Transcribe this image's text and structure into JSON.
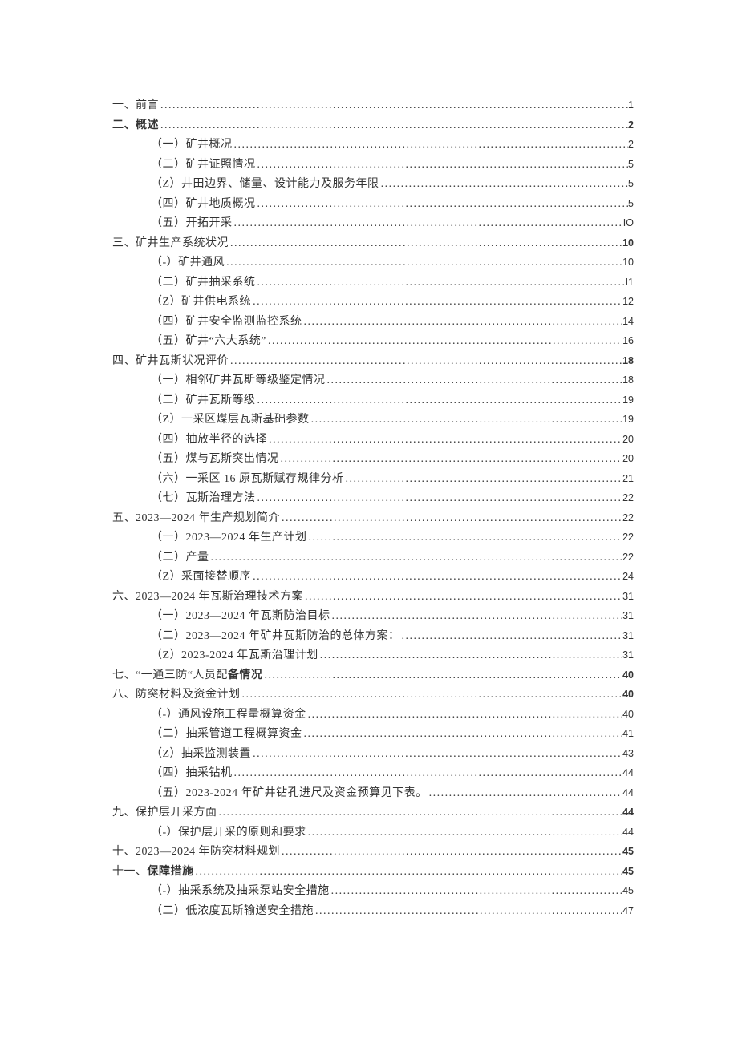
{
  "toc": [
    {
      "level": 1,
      "label": "一、前言",
      "page": "1",
      "style": ""
    },
    {
      "level": 1,
      "label": "二、概述",
      "page": "2",
      "style": "bold"
    },
    {
      "level": 2,
      "label": "（一）矿井概况",
      "page": "2",
      "style": ""
    },
    {
      "level": 2,
      "label": "（二）矿井证照情况",
      "page": "5",
      "style": ""
    },
    {
      "level": 2,
      "label": "（Z）井田边界、储量、设计能力及服务年限",
      "page": "5",
      "style": ""
    },
    {
      "level": 2,
      "label": "（四）矿井地质概况",
      "page": "5",
      "style": ""
    },
    {
      "level": 2,
      "label": "（五）开拓开采",
      "page": "IO",
      "style": ""
    },
    {
      "level": 1,
      "label": "三、矿井生产系统状况",
      "page": "10",
      "style": "bold-page"
    },
    {
      "level": 2,
      "label": "（-）矿井通风",
      "page": "10",
      "style": ""
    },
    {
      "level": 2,
      "label": "（二）矿井抽采系统",
      "page": "I1",
      "style": ""
    },
    {
      "level": 2,
      "label": "（Z）矿井供电系统",
      "page": "12",
      "style": ""
    },
    {
      "level": 2,
      "label": "（四）矿井安全监测监控系统",
      "page": "14",
      "style": ""
    },
    {
      "level": 2,
      "label": "（五）矿井“六大系统”",
      "page": "16",
      "style": ""
    },
    {
      "level": 1,
      "label": "四、矿井瓦斯状况评价",
      "page": "18",
      "style": "bold-page"
    },
    {
      "level": 2,
      "label": "（一）相邻矿井瓦斯等级鉴定情况",
      "page": "18",
      "style": ""
    },
    {
      "level": 2,
      "label": "（二）矿井瓦斯等级",
      "page": "19",
      "style": ""
    },
    {
      "level": 2,
      "label": "（Z）一采区煤层瓦斯基础参数",
      "page": "19",
      "style": ""
    },
    {
      "level": 2,
      "label": "（四）抽放半径的选择",
      "page": "20",
      "style": ""
    },
    {
      "level": 2,
      "label": "（五）煤与瓦斯突出情况",
      "page": "20",
      "style": ""
    },
    {
      "level": 2,
      "label": "（六）一采区 16 原瓦斯赋存规律分析",
      "page": "21",
      "style": ""
    },
    {
      "level": 2,
      "label": "（七）瓦斯治理方法",
      "page": "22",
      "style": ""
    },
    {
      "level": 1,
      "label": "五、2023—2024 年生产规划简介",
      "page": "22",
      "style": ""
    },
    {
      "level": 2,
      "label": "（一）2023—2024 年生产计划",
      "page": "22",
      "style": ""
    },
    {
      "level": 2,
      "label": "（二）产量",
      "page": "22",
      "style": ""
    },
    {
      "level": 2,
      "label": "（Z）采面接替顺序",
      "page": "24",
      "style": ""
    },
    {
      "level": 1,
      "label": "六、2023—2024 年瓦斯治理技术方案",
      "page": "31",
      "style": ""
    },
    {
      "level": 2,
      "label": "（一）2023—2024 年瓦斯防治目标",
      "page": "31",
      "style": ""
    },
    {
      "level": 2,
      "label": "（二）2023—2024 年矿井瓦斯防治的总体方案：",
      "page": "31",
      "style": ""
    },
    {
      "level": 2,
      "label": "（Z）2023-2024 年瓦斯治理计划",
      "page": "31",
      "style": ""
    },
    {
      "level": 1,
      "label": "七、“一通三防“人员配备情况",
      "page": "40",
      "style": "bold-partial",
      "partial_plain": "七、“一通三防“人员配",
      "partial_bold": "备情况"
    },
    {
      "level": 1,
      "label": "八、防突材料及资金计划",
      "page": "40",
      "style": "bold-page"
    },
    {
      "level": 2,
      "label": "（-）通风设施工程量概算资金",
      "page": "40",
      "style": ""
    },
    {
      "level": 2,
      "label": "（二）抽采管道工程概算资金",
      "page": "41",
      "style": ""
    },
    {
      "level": 2,
      "label": "（Z）抽采监测装置",
      "page": "43",
      "style": ""
    },
    {
      "level": 2,
      "label": "（四）抽采钻机",
      "page": "44",
      "style": ""
    },
    {
      "level": 2,
      "label": "（五）2023-2024 年矿井钻孔进尺及资金预算见下表。",
      "page": "44",
      "style": ""
    },
    {
      "level": 1,
      "label": "九、保护层开采方面",
      "page": "44",
      "style": "bold-page"
    },
    {
      "level": 2,
      "label": "（-）保护层开采的原则和要求",
      "page": "44",
      "style": ""
    },
    {
      "level": 1,
      "label": "十、2023—2024 年防突材料规划",
      "page": "45",
      "style": "bold-page"
    },
    {
      "level": 1,
      "label": "十一、保障措施",
      "page": "45",
      "style": "bold-partial",
      "partial_plain": "十一、",
      "partial_bold": "保障措施"
    },
    {
      "level": 2,
      "label": "（-）抽采系统及抽采泵站安全措施",
      "page": "45",
      "style": ""
    },
    {
      "level": 2,
      "label": "（二）低浓度瓦斯输送安全措施",
      "page": "47",
      "style": ""
    }
  ]
}
